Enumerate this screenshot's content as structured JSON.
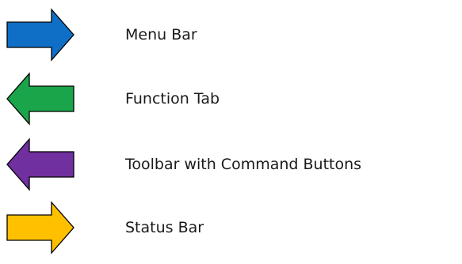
{
  "legend": {
    "items": [
      {
        "label": "Menu Bar",
        "direction": "right",
        "color": "#0f6fc6",
        "icon": "right-arrow-icon"
      },
      {
        "label": "Function Tab",
        "direction": "left",
        "color": "#1aa54b",
        "icon": "left-arrow-icon"
      },
      {
        "label": "Toolbar with Command Buttons",
        "direction": "left",
        "color": "#7030a0",
        "icon": "left-arrow-icon"
      },
      {
        "label": "Status Bar",
        "direction": "right",
        "color": "#ffc000",
        "icon": "right-arrow-icon"
      }
    ]
  }
}
